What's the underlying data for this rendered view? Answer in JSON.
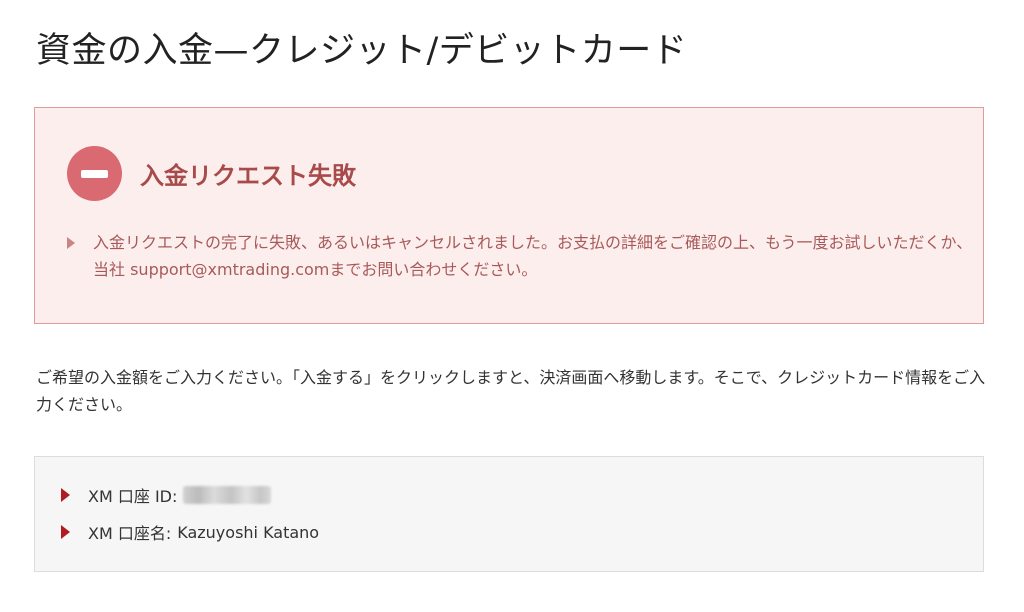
{
  "page": {
    "title": "資金の入金—クレジット/デビットカード"
  },
  "error": {
    "icon": "minus-circle-icon",
    "title": "入金リクエスト失敗",
    "message": "入金リクエストの完了に失敗、あるいはキャンセルされました。お支払の詳細をご確認の上、もう一度お試しいただくか、当社 support@xmtrading.comまでお問い合わせください。"
  },
  "instructions": "ご希望の入金額をご入力ください。「入金する」をクリックしますと、決済画面へ移動します。そこで、クレジットカード情報をご入力ください。",
  "account": {
    "id_label": "XM 口座 ID:",
    "id_value": "",
    "name_label": "XM 口座名:",
    "name_value": "Kazuyoshi Katano"
  },
  "colors": {
    "error_bg": "#fdeeee",
    "error_border": "#e39a9a",
    "error_icon": "#d96a72",
    "error_title": "#a84a4a",
    "bullet_red": "#b01c24"
  }
}
